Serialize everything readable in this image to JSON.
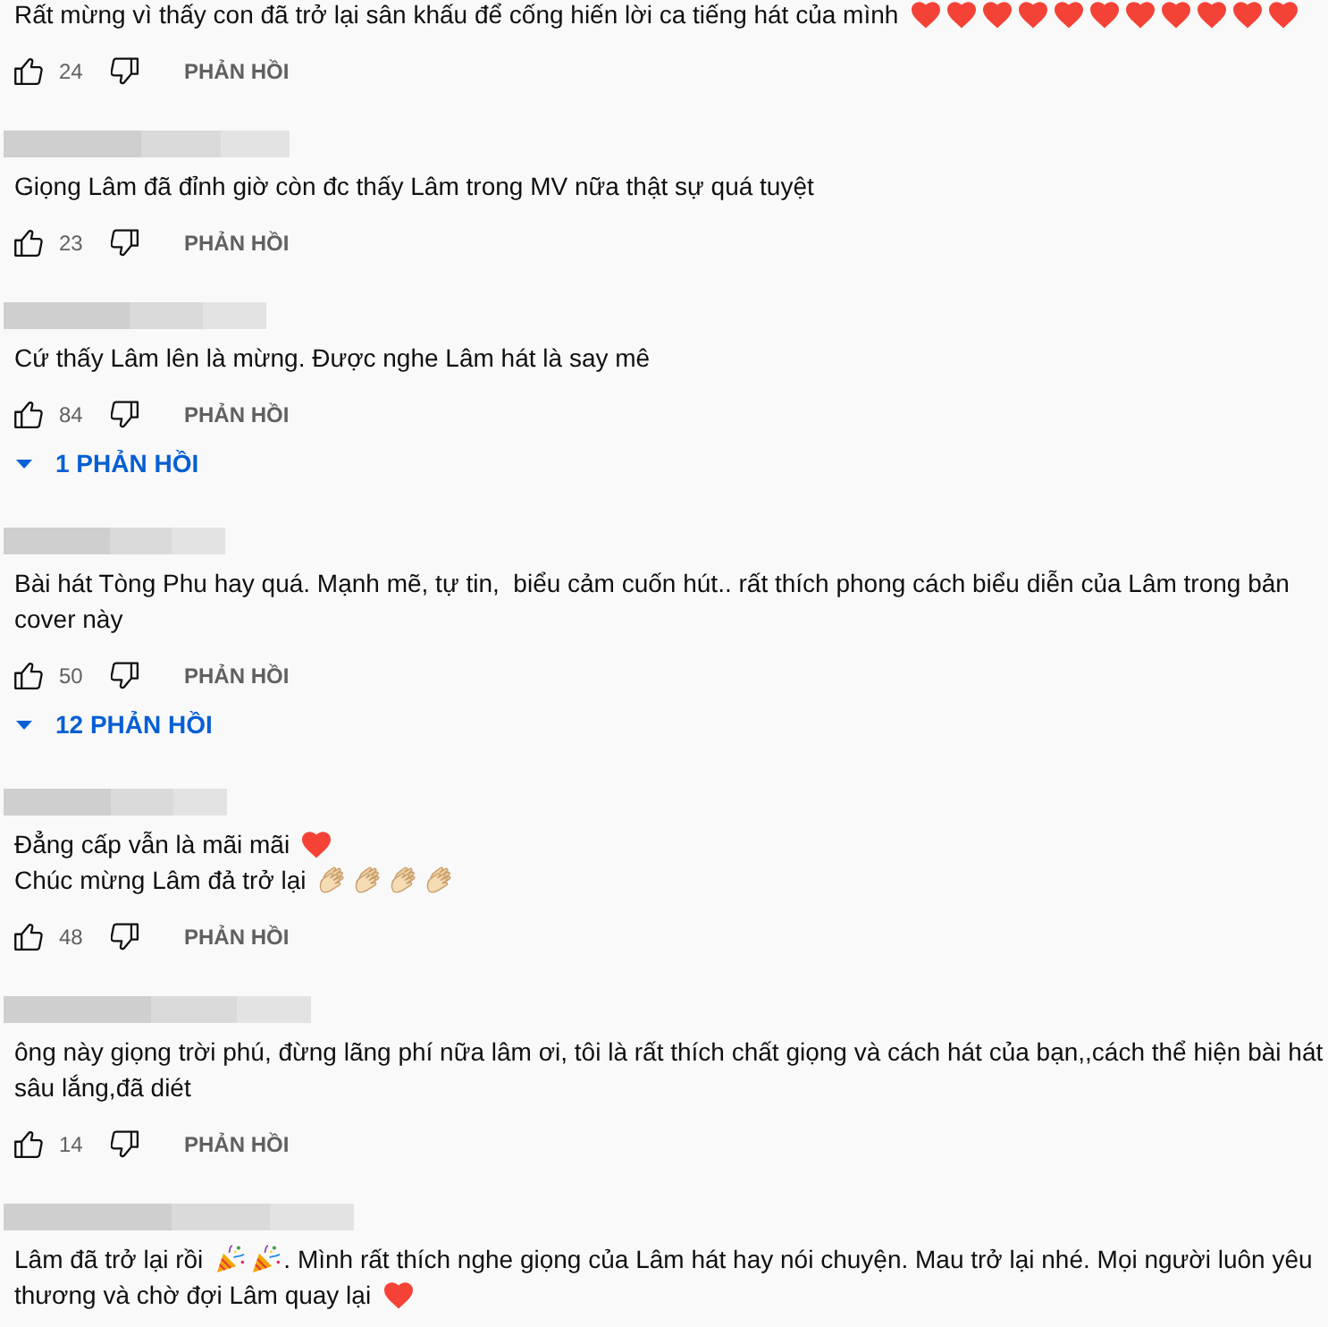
{
  "comments": [
    {
      "lines": [
        [
          {
            "kind": "text",
            "text": "Rất mừng vì thấy con đã trở lại sân khấu để cống hiến lời ca tiếng hát của mình"
          },
          {
            "kind": "heart"
          },
          {
            "kind": "heart"
          },
          {
            "kind": "heart"
          },
          {
            "kind": "heart"
          },
          {
            "kind": "heart"
          },
          {
            "kind": "heart"
          },
          {
            "kind": "heart"
          },
          {
            "kind": "heart"
          },
          {
            "kind": "heart"
          },
          {
            "kind": "heart"
          },
          {
            "kind": "heart"
          }
        ]
      ],
      "likes": "24",
      "reply_button": "PHẢN HỒI"
    },
    {
      "author_blurred": true,
      "lines": [
        [
          {
            "kind": "text",
            "text": "Giọng Lâm đã đỉnh giờ còn đc thấy Lâm trong MV nữa thật sự quá tuyệt"
          }
        ]
      ],
      "likes": "23",
      "reply_button": "PHẢN HỒI"
    },
    {
      "author_blurred": true,
      "lines": [
        [
          {
            "kind": "text",
            "text": "Cứ thấy Lâm lên là mừng. Được nghe Lâm hát là say mê"
          }
        ]
      ],
      "likes": "84",
      "reply_button": "PHẢN HỒI",
      "replies_toggle": "1 PHẢN HỒI"
    },
    {
      "author_blurred": true,
      "lines": [
        [
          {
            "kind": "text",
            "text": "Bài hát Tòng Phu hay quá. Mạnh mẽ, tự tin,  biểu cảm cuốn hút.. rất thích phong cách biểu diễn của Lâm trong bản"
          }
        ],
        [
          {
            "kind": "text",
            "text": "cover này"
          }
        ]
      ],
      "likes": "50",
      "reply_button": "PHẢN HỒI",
      "replies_toggle": "12 PHẢN HỒI"
    },
    {
      "author_blurred": true,
      "lines": [
        [
          {
            "kind": "text",
            "text": "Đẳng cấp vẫn là mãi mãi"
          },
          {
            "kind": "heart"
          }
        ],
        [
          {
            "kind": "text",
            "text": "Chúc mừng Lâm đả trở lại"
          },
          {
            "kind": "clap"
          },
          {
            "kind": "clap"
          },
          {
            "kind": "clap"
          },
          {
            "kind": "clap"
          }
        ]
      ],
      "likes": "48",
      "reply_button": "PHẢN HỒI"
    },
    {
      "author_blurred": true,
      "lines": [
        [
          {
            "kind": "text",
            "text": "ông này giọng trời phú, đừng lãng phí nữa lâm ơi, tôi là rất thích chất giọng và cách hát của bạn,,cách thể hiện bài hát"
          }
        ],
        [
          {
            "kind": "text",
            "text": "sâu lắng,đã diét"
          }
        ]
      ],
      "likes": "14",
      "reply_button": "PHẢN HỒI"
    },
    {
      "author_blurred": true,
      "lines": [
        [
          {
            "kind": "text",
            "text": "Lâm đã trở lại rồi"
          },
          {
            "kind": "party"
          },
          {
            "kind": "party"
          },
          {
            "kind": "text",
            "text": ". Mình rất thích nghe giọng của Lâm hát hay nói chuyện. Mau trở lại nhé. Mọi người luôn yêu"
          }
        ],
        [
          {
            "kind": "text",
            "text": "thương và chờ đợi Lâm quay lại"
          },
          {
            "kind": "heart"
          }
        ]
      ]
    }
  ]
}
